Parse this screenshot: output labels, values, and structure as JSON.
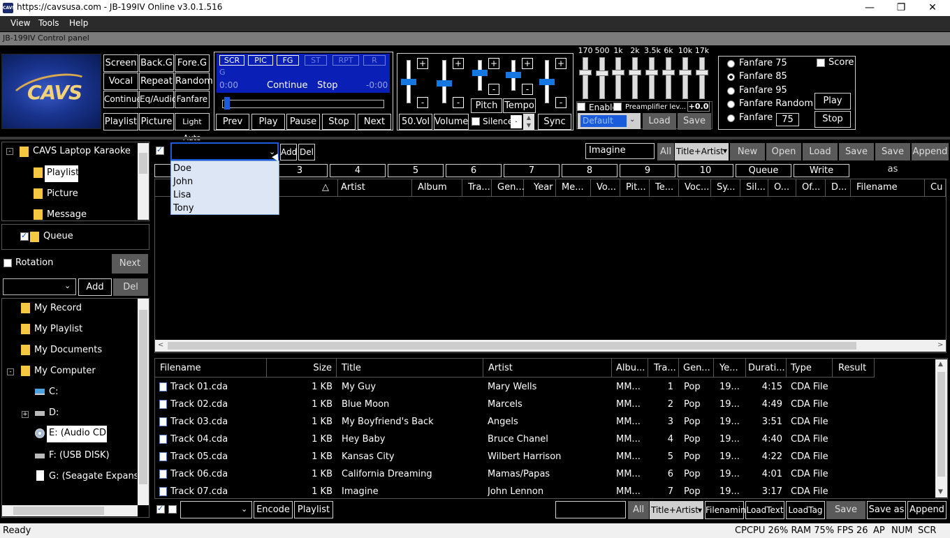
{
  "window": {
    "title": "https://cavsusa.com - JB-199IV Online v3.0.1.516",
    "app_icon": "CAVS"
  },
  "menu": [
    "View",
    "Tools",
    "Help"
  ],
  "panel_title": "JB-199IV Control panel",
  "logo_text": "CAVS",
  "keys": {
    "row1": [
      "Screen",
      "Back.G",
      "Fore.G"
    ],
    "row2": [
      "Vocal",
      "Repeat",
      "Random"
    ],
    "row3": [
      "Continue",
      "Eq/Audio",
      "Fanfare"
    ],
    "row4": [
      "Playlist",
      "Picture",
      "Light Auto"
    ]
  },
  "player": {
    "mode_buttons": [
      "SCR",
      "PIC",
      "FG",
      "ST",
      "RPT",
      "R"
    ],
    "key_letter": "G",
    "time_left": "0:00",
    "mode": "Continue",
    "state": "Stop",
    "time_right": "-0:00",
    "transport": [
      "Prev",
      "Play",
      "Pause",
      "Stop",
      "Next"
    ]
  },
  "mixer": {
    "vol_label": "50.Vol",
    "volume_label": "Volume",
    "pitch_label": "Pitch",
    "tempo_label": "Tempo",
    "silence_label": "Silence",
    "silence_value": ".",
    "sync_label": "Sync",
    "plus": "+",
    "minus": "-"
  },
  "eq": {
    "bands": [
      "170",
      "500",
      "1k",
      "2k",
      "3.5k",
      "6k",
      "10k",
      "17k"
    ],
    "enable_label": "Enable",
    "preamp_label": "Preamplifier lev...",
    "preamp_value": "+0.0",
    "preset": "Default",
    "load": "Load",
    "save": "Save"
  },
  "fanfare": {
    "options": [
      "Fanfare 75",
      "Fanfare 85",
      "Fanfare 95",
      "Fanfare Random",
      "Fanfare"
    ],
    "selected": "Fanfare 85",
    "custom_value": "75",
    "score_label": "Score",
    "play": "Play",
    "stop": "Stop"
  },
  "tree_top": {
    "root": "CAVS Laptop Karaoke",
    "items": [
      "Playlist",
      "Picture",
      "Message"
    ],
    "expand_glyph": "-"
  },
  "queue_label": "Queue",
  "rotation_label": "Rotation",
  "next_label": "Next",
  "user_add": "Add",
  "user_del": "Del",
  "tree_bottom": {
    "items": [
      "My Record",
      "My Playlist",
      "My Documents",
      "My Computer"
    ],
    "drives": [
      "C:",
      "D:",
      "E: (Audio CD)",
      "F: (USB DISK)",
      "G: (Seagate Expansio"
    ],
    "expand_minus": "-",
    "expand_plus": "+"
  },
  "singer": {
    "add": "Add",
    "del": "Del",
    "dropdown": [
      "Doe",
      "John",
      "Lisa",
      "Tony"
    ]
  },
  "search": {
    "value": "Imagine",
    "all": "All",
    "mode": "Title+Artist",
    "actions": [
      "New",
      "Open",
      "Load",
      "Save",
      "Save as",
      "Append"
    ]
  },
  "tabs": [
    "3",
    "4",
    "5",
    "6",
    "7",
    "8",
    "9",
    "10",
    "Queue",
    "Write"
  ],
  "playlist_columns": [
    "Artist",
    "Album",
    "Tra...",
    "Gen...",
    "Year",
    "Me...",
    "Vo...",
    "Pit...",
    "Te...",
    "Voc...",
    "Sy...",
    "Sil...",
    "O...",
    "Of...",
    "D...",
    "Filename",
    "Cu"
  ],
  "sort_glyph": "△",
  "file_columns": [
    "Filename",
    "Size",
    "Title",
    "Artist",
    "Albu...",
    "Tra...",
    "Gen...",
    "Ye...",
    "Durati...",
    "Type",
    "Result"
  ],
  "files": [
    {
      "filename": "Track 01.cda",
      "size": "1 KB",
      "title": "My Guy",
      "artist": "Mary Wells",
      "album": "MM...",
      "track": "1",
      "genre": "Pop",
      "year": "19...",
      "duration": "4:15",
      "type": "CDA File"
    },
    {
      "filename": "Track 02.cda",
      "size": "1 KB",
      "title": "Blue Moon",
      "artist": "Marcels",
      "album": "MM...",
      "track": "2",
      "genre": "Pop",
      "year": "19...",
      "duration": "4:49",
      "type": "CDA File"
    },
    {
      "filename": "Track 03.cda",
      "size": "1 KB",
      "title": "My Boyfriend's Back",
      "artist": "Angels",
      "album": "MM...",
      "track": "3",
      "genre": "Pop",
      "year": "19...",
      "duration": "3:51",
      "type": "CDA File"
    },
    {
      "filename": "Track 04.cda",
      "size": "1 KB",
      "title": "Hey Baby",
      "artist": "Bruce Chanel",
      "album": "MM...",
      "track": "4",
      "genre": "Pop",
      "year": "19...",
      "duration": "4:40",
      "type": "CDA File"
    },
    {
      "filename": "Track 05.cda",
      "size": "1 KB",
      "title": "Kansas City",
      "artist": "Wilbert Harrison",
      "album": "MM...",
      "track": "5",
      "genre": "Pop",
      "year": "19...",
      "duration": "4:22",
      "type": "CDA File"
    },
    {
      "filename": "Track 06.cda",
      "size": "1 KB",
      "title": "California Dreaming",
      "artist": "Mamas/Papas",
      "album": "MM...",
      "track": "6",
      "genre": "Pop",
      "year": "19...",
      "duration": "4:01",
      "type": "CDA File"
    },
    {
      "filename": "Track 07.cda",
      "size": "1 KB",
      "title": "Imagine",
      "artist": "John Lennon",
      "album": "MM...",
      "track": "7",
      "genre": "Pop",
      "year": "19...",
      "duration": "3:17",
      "type": "CDA File"
    }
  ],
  "bottom_bar": {
    "encode": "Encode",
    "playlist": "Playlist",
    "all": "All",
    "mode": "Title+Artist",
    "buttons": [
      "Filenaming",
      "LoadText",
      "LoadTag",
      "Save",
      "Save as",
      "Append"
    ]
  },
  "status": {
    "left": "Ready",
    "right": "CPCPU 26% RAM 75% FPS 26",
    "ap": "AP",
    "num": "NUM",
    "scr": "SCR"
  },
  "colors": {
    "accent": "#1a5bdb",
    "player_screen": "#0a1fb5",
    "folder": "#f4c842"
  }
}
